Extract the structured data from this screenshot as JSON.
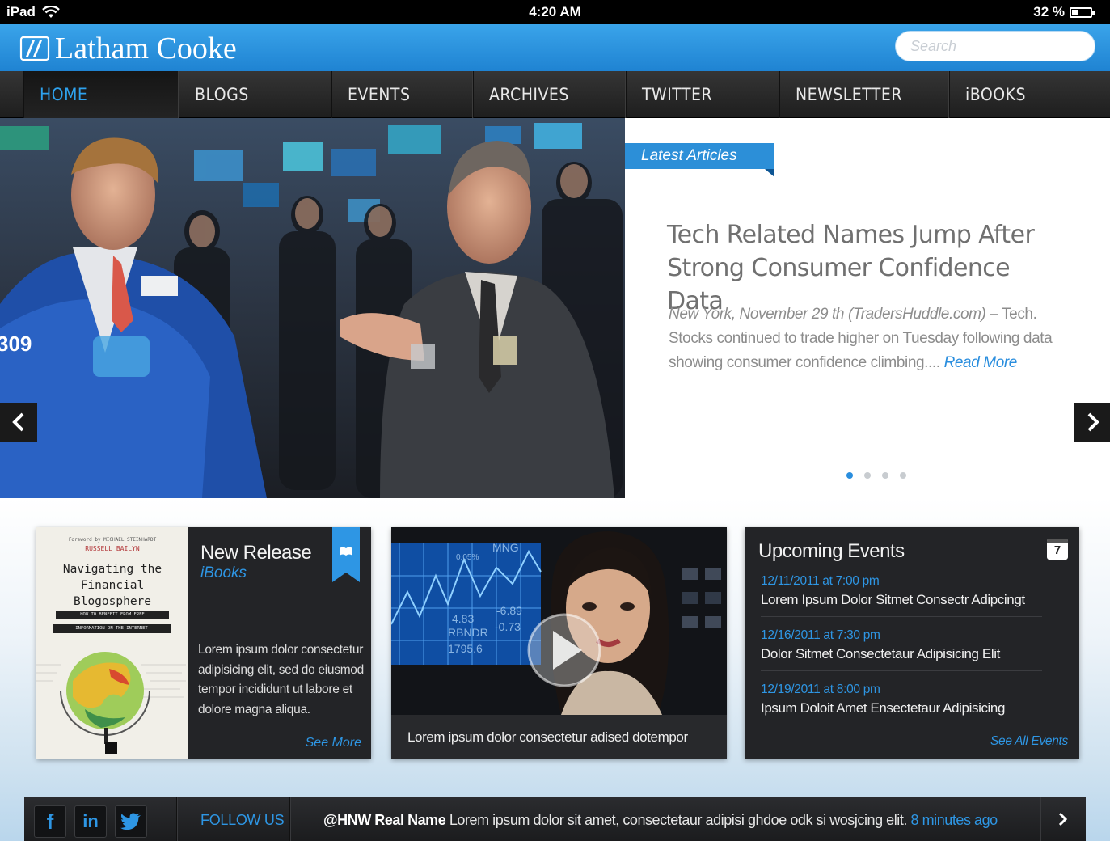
{
  "status_bar": {
    "device": "iPad",
    "time": "4:20 AM",
    "battery": "32 %",
    "battery_level": 0.32
  },
  "header": {
    "brand": "Latham Cooke",
    "search_placeholder": "Search"
  },
  "nav": {
    "items": [
      {
        "label": "HOME",
        "active": true
      },
      {
        "label": "BLOGS"
      },
      {
        "label": "EVENTS"
      },
      {
        "label": "ARCHIVES"
      },
      {
        "label": "TWITTER"
      },
      {
        "label": "NEWSLETTER"
      },
      {
        "label": "iBOOKS"
      }
    ]
  },
  "hero": {
    "photo_badge": "309",
    "ribbon": "Latest Articles",
    "headline": "Tech Related Names Jump After Strong Consumer Confidence Data",
    "dateline": "New York, November 29 th (TradersHuddle.com)",
    "summary": " – Tech. Stocks continued to trade higher on Tuesday following data showing consumer confidence climbing.... ",
    "read_more": "Read More",
    "slide_count": 4,
    "active_slide": 1
  },
  "book": {
    "cover": {
      "foreword": "Foreword by MICHAEL STEINHARDT",
      "author": "RUSSELL BAILYN",
      "title_lines": [
        "Navigating the",
        "Financial",
        "Blogosphere"
      ],
      "band1": "HOW TO BENEFIT FROM FREE",
      "band2": "INFORMATION ON THE INTERNET"
    },
    "title": "New Release",
    "subtitle": "iBooks",
    "body": "Lorem ipsum dolor consectetur adipisicing elit, sed do eiusmod tempor incididunt ut labore et dolore magna aliqua.",
    "link": "See More"
  },
  "video": {
    "caption": "Lorem ipsum dolor consectetur adised dotempor",
    "ticker": [
      "MNG",
      "0.05%",
      "4.83",
      "-6.89",
      "RBNDR",
      "-0.73",
      "1795.6"
    ]
  },
  "events": {
    "title": "Upcoming Events",
    "calendar_day": "7",
    "items": [
      {
        "date": "12/11/2011 at 7:00 pm",
        "title": "Lorem Ipsum Dolor Sitmet Consectr Adipcingt"
      },
      {
        "date": "12/16/2011 at 7:30 pm",
        "title": "Dolor Sitmet Consectetaur Adipisicing Elit"
      },
      {
        "date": "12/19/2011 at 8:00 pm",
        "title": "Ipsum Doloit Amet Ensectetaur Adipisicing"
      }
    ],
    "link": "See All Events"
  },
  "footer": {
    "social": [
      {
        "icon": "facebook-icon",
        "glyph": "f"
      },
      {
        "icon": "linkedin-icon",
        "glyph": "in"
      },
      {
        "icon": "twitter-icon",
        "glyph": ""
      }
    ],
    "follow": "FOLLOW US",
    "tweet_handle": "@HNW Real Name",
    "tweet_text": " Lorem ipsum dolor sit amet, consectetaur adipisi ghdoe odk si wosjcing elit. ",
    "tweet_time": "8 minutes ago"
  },
  "colors": {
    "accent": "#2e96e4",
    "header_blue": "#2a8ede",
    "nav_bg": "#252525",
    "card_bg": "#232427"
  }
}
